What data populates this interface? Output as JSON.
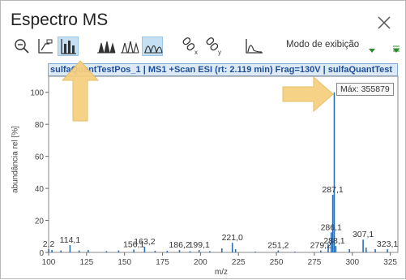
{
  "window": {
    "title": "Espectro MS",
    "close_icon": "close-icon"
  },
  "toolbar": {
    "buttons": [
      "zoom-icon",
      "axis-icon",
      "chart-settings-icon",
      "peaks-icon-1",
      "peaks-icon-2",
      "peaks-icon-3",
      "unlink-x-icon",
      "unlink-y-icon",
      "curve-icon"
    ],
    "mode_label": "Modo de exibição",
    "accent": "#2e8b2e"
  },
  "plot": {
    "header": "sulfaQuantTestPos_1 | MS1 +Scan ESI (rt: 2.119 min) Frag=130V | sulfaQuantTest",
    "ylabel": "abundância rel [%]",
    "xlabel": "m/z",
    "tooltip": "Máx: 355879",
    "line_color": "#2a6fb5"
  },
  "chart_data": {
    "type": "bar",
    "xlabel": "m/z",
    "ylabel": "abundância rel [%]",
    "xlim": [
      100,
      330
    ],
    "ylim": [
      0,
      110
    ],
    "xticks": [
      100,
      125,
      150,
      175,
      200,
      225,
      250,
      275,
      300,
      325
    ],
    "yticks": [
      0,
      20,
      40,
      60,
      80,
      100
    ],
    "x": [
      100,
      102.2,
      108.1,
      114.1,
      120.1,
      126.1,
      138.1,
      146.1,
      156.1,
      163.2,
      170.1,
      178.1,
      186.2,
      193.1,
      199.1,
      206.1,
      214.1,
      221.0,
      223.1,
      236.1,
      251.2,
      262.1,
      279.2,
      284.1,
      286.1,
      287.1,
      288.1,
      289.1,
      298.1,
      307.1,
      309.1,
      315.1,
      323.1
    ],
    "values": [
      2.0,
      1.5,
      1.2,
      4.5,
      1.2,
      1.5,
      0.8,
      1.2,
      1.8,
      3.5,
      1.0,
      1.0,
      1.5,
      0.8,
      1.5,
      0.8,
      2.5,
      6.0,
      2.0,
      0.5,
      1.2,
      0.5,
      1.2,
      5.0,
      12.5,
      36.0,
      100.0,
      4.0,
      2.0,
      8.0,
      3.0,
      2.0,
      2.0
    ],
    "annotations": [
      {
        "label": "2,2",
        "x": 100,
        "y": 2.0
      },
      {
        "label": "114,1",
        "x": 114.1,
        "y": 4.5
      },
      {
        "label": "156,1",
        "x": 156.1,
        "y": 1.8
      },
      {
        "label": "163,2",
        "x": 163.2,
        "y": 3.5
      },
      {
        "label": "186,2",
        "x": 186.2,
        "y": 1.5
      },
      {
        "label": "199,1",
        "x": 199.1,
        "y": 1.5
      },
      {
        "label": "221,0",
        "x": 221.0,
        "y": 6.0
      },
      {
        "label": "251,2",
        "x": 251.2,
        "y": 1.2
      },
      {
        "label": "279,2",
        "x": 279.2,
        "y": 1.2
      },
      {
        "label": "288,1",
        "x": 288.1,
        "y": 4.0
      },
      {
        "label": "286,1",
        "x": 286.1,
        "y": 12.5
      },
      {
        "label": "287,1",
        "x": 287.1,
        "y": 36.0
      },
      {
        "label": "307,1",
        "x": 307.1,
        "y": 8.0
      },
      {
        "label": "323,1",
        "x": 323.1,
        "y": 2.0
      }
    ],
    "grid": false
  }
}
